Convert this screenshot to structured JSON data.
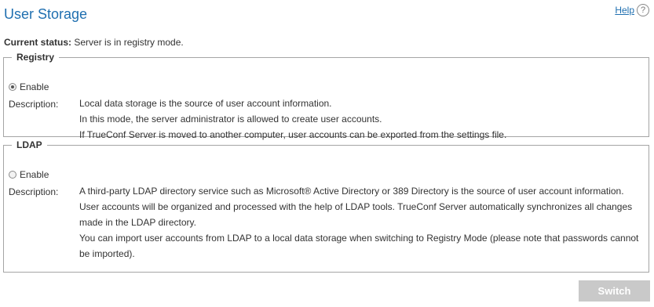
{
  "page": {
    "title": "User Storage",
    "help_label": "Help",
    "help_icon": "?"
  },
  "status": {
    "label": "Current status:",
    "value": " Server is in registry mode."
  },
  "registry": {
    "legend": "Registry",
    "enable_label": "Enable",
    "enabled": true,
    "description_label": "Description:",
    "lines": [
      "Local data storage is the source of user account information.",
      "In this mode, the server administrator is allowed to create user accounts.",
      "If TrueConf Server is moved to another computer, user accounts can be exported from the settings file."
    ]
  },
  "ldap": {
    "legend": "LDAP",
    "enable_label": "Enable",
    "enabled": false,
    "description_label": "Description:",
    "lines": [
      "A third-party LDAP directory service such as Microsoft® Active Directory or 389 Directory is the source of user account information.",
      "User accounts will be organized and processed with the help of LDAP tools. TrueConf Server automatically synchronizes all changes made in the LDAP directory.",
      "You can import user accounts from LDAP to a local data storage when switching to Registry Mode (please note that passwords cannot be imported)."
    ]
  },
  "actions": {
    "switch_label": "Switch"
  }
}
